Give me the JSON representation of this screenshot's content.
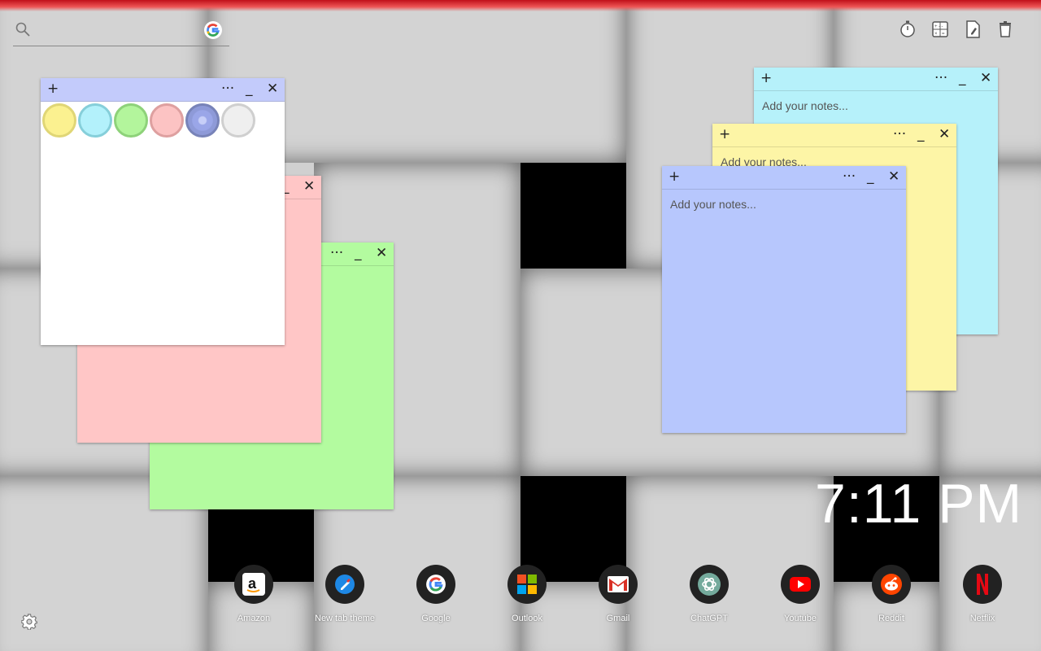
{
  "search": {
    "placeholder": ""
  },
  "tools": [
    {
      "name": "stopwatch-icon"
    },
    {
      "name": "calculator-icon"
    },
    {
      "name": "edit-document-icon"
    },
    {
      "name": "trash-icon"
    }
  ],
  "notes": {
    "white": {
      "plus": "+",
      "more": "···",
      "min": "_",
      "close": "✕",
      "bg": "#ffffff",
      "header": "#c3cbfb"
    },
    "pink": {
      "min": "_",
      "close": "✕",
      "bg": "#ffc6c6"
    },
    "green": {
      "more": "···",
      "min": "_",
      "close": "✕",
      "bg": "#b3fb9f"
    },
    "cyan": {
      "plus": "+",
      "more": "···",
      "min": "_",
      "close": "✕",
      "placeholder": "Add your notes...",
      "bg": "#b6f1fa"
    },
    "yellow": {
      "plus": "+",
      "more": "···",
      "min": "_",
      "close": "✕",
      "placeholder": "Add your notes...",
      "bg": "#fdf5a6"
    },
    "blue": {
      "plus": "+",
      "more": "···",
      "min": "_",
      "close": "✕",
      "placeholder": "Add your notes...",
      "bg": "#b7c7fd"
    }
  },
  "swatches": [
    {
      "name": "yellow-swatch",
      "fill": "#fbf190",
      "ring": "#e0d676"
    },
    {
      "name": "cyan-swatch",
      "fill": "#b3f1fb",
      "ring": "#86cfda"
    },
    {
      "name": "green-swatch",
      "fill": "#b3f59c",
      "ring": "#8ed27a"
    },
    {
      "name": "pink-swatch",
      "fill": "#fcc3c3",
      "ring": "#dea0a0"
    },
    {
      "name": "blue-swatch",
      "fill": "#9aa6e8",
      "ring": "#7883b8",
      "selected": true
    },
    {
      "name": "white-swatch",
      "fill": "#efefef",
      "ring": "#cfcfcf"
    }
  ],
  "clock": {
    "time": "7:11 PM"
  },
  "dock": [
    {
      "label": "Amazon",
      "icon": "amazon-icon"
    },
    {
      "label": "New tab theme",
      "icon": "new-tab-theme-icon"
    },
    {
      "label": "Google",
      "icon": "google-icon"
    },
    {
      "label": "Outlook",
      "icon": "outlook-icon"
    },
    {
      "label": "Gmail",
      "icon": "gmail-icon"
    },
    {
      "label": "ChatGPT",
      "icon": "chatgpt-icon"
    },
    {
      "label": "Youtube",
      "icon": "youtube-icon"
    },
    {
      "label": "Reddit",
      "icon": "reddit-icon"
    },
    {
      "label": "Netflix",
      "icon": "netflix-icon"
    }
  ]
}
